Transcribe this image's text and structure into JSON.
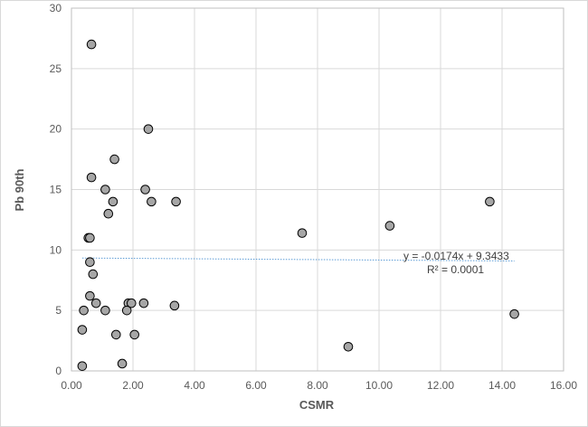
{
  "chart_data": {
    "type": "scatter",
    "title": "",
    "xlabel": "CSMR",
    "ylabel": "Pb 90th",
    "xlim": [
      0,
      16
    ],
    "ylim": [
      0,
      30
    ],
    "x_ticks": [
      "0.00",
      "2.00",
      "4.00",
      "6.00",
      "8.00",
      "10.00",
      "12.00",
      "14.00",
      "16.00"
    ],
    "y_ticks": [
      "0",
      "5",
      "10",
      "15",
      "20",
      "25",
      "30"
    ],
    "grid": true,
    "marker_color": "#a6a6a6",
    "marker_edge": "#000000",
    "trendline_color": "#5b9bd5",
    "points": [
      {
        "x": 0.65,
        "y": 27
      },
      {
        "x": 2.5,
        "y": 20
      },
      {
        "x": 1.4,
        "y": 17.5
      },
      {
        "x": 0.65,
        "y": 16
      },
      {
        "x": 1.1,
        "y": 15
      },
      {
        "x": 2.4,
        "y": 15
      },
      {
        "x": 1.35,
        "y": 14
      },
      {
        "x": 2.6,
        "y": 14
      },
      {
        "x": 3.4,
        "y": 14
      },
      {
        "x": 13.6,
        "y": 14
      },
      {
        "x": 1.2,
        "y": 13
      },
      {
        "x": 10.35,
        "y": 12
      },
      {
        "x": 7.5,
        "y": 11.4
      },
      {
        "x": 0.55,
        "y": 11
      },
      {
        "x": 0.6,
        "y": 11
      },
      {
        "x": 0.6,
        "y": 9
      },
      {
        "x": 0.7,
        "y": 8
      },
      {
        "x": 0.6,
        "y": 6.2
      },
      {
        "x": 0.8,
        "y": 5.6
      },
      {
        "x": 1.85,
        "y": 5.6
      },
      {
        "x": 1.95,
        "y": 5.6
      },
      {
        "x": 2.35,
        "y": 5.6
      },
      {
        "x": 3.35,
        "y": 5.4
      },
      {
        "x": 0.4,
        "y": 5
      },
      {
        "x": 1.1,
        "y": 5
      },
      {
        "x": 1.8,
        "y": 5
      },
      {
        "x": 14.4,
        "y": 4.7
      },
      {
        "x": 0.35,
        "y": 3.4
      },
      {
        "x": 1.45,
        "y": 3
      },
      {
        "x": 2.05,
        "y": 3
      },
      {
        "x": 9.0,
        "y": 2
      },
      {
        "x": 1.65,
        "y": 0.6
      },
      {
        "x": 0.35,
        "y": 0.4
      }
    ],
    "trendline": {
      "slope": -0.0174,
      "intercept": 9.3433,
      "x_range": [
        0.35,
        14.4
      ],
      "equation": "y = -0.0174x + 9.3433",
      "r2": "R² = 0.0001"
    }
  }
}
